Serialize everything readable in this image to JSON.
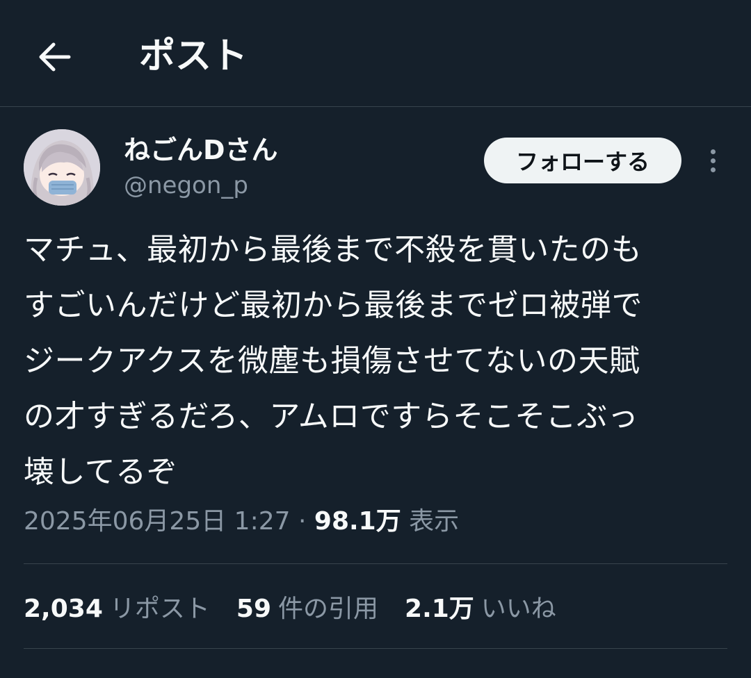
{
  "header": {
    "back_icon": "arrow-left-icon",
    "title": "ポスト"
  },
  "author": {
    "display_name": "ねごんDさん",
    "handle": "@negon_p",
    "avatar_icon": "anime-girl-avatar"
  },
  "follow_button": {
    "label": "フォローする"
  },
  "more_icon": "more-vertical-icon",
  "post": {
    "lines": [
      "マチュ、最初から最後まで不殺を貫いたのも",
      "すごいんだけど最初から最後までゼロ被弾で",
      "ジークアクスを微塵も損傷させてないの天賦",
      "の才すぎるだろ、アムロですらそこそこぶっ",
      "壊してるぞ"
    ]
  },
  "meta": {
    "timestamp": "2025年06月25日 1:27",
    "separator": "·",
    "views_count": "98.1万",
    "views_label": "表示"
  },
  "stats": {
    "reposts": {
      "count": "2,034",
      "label": "リポスト"
    },
    "quotes": {
      "count": "59",
      "label": "件の引用"
    },
    "likes": {
      "count": "2.1万",
      "label": "いいね"
    }
  },
  "colors": {
    "background": "#15202b",
    "text": "#f7f9f9",
    "muted": "#8b98a5",
    "divider": "#38444d",
    "follow_bg": "#eff3f4"
  }
}
